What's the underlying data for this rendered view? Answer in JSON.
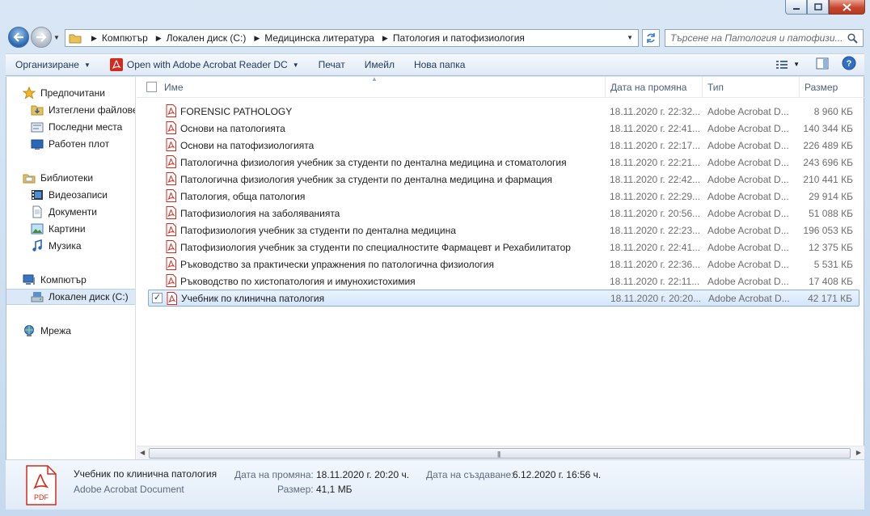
{
  "window": {
    "minimize_glyph": "—",
    "maximize_glyph": "□",
    "close_glyph": "✕"
  },
  "address": {
    "crumbs": [
      "Компютър",
      "Локален диск (C:)",
      "Медицинска литература",
      "Патология и патофизиология"
    ],
    "search_placeholder": "Търсене на Патология и патофизи..."
  },
  "toolbar": {
    "organize_label": "Организиране",
    "open_with_label": "Open with Adobe Acrobat Reader DC",
    "print_label": "Печат",
    "email_label": "Имейл",
    "new_folder_label": "Нова папка"
  },
  "nav": {
    "favorites": "Предпочитани",
    "downloads": "Изтеглени файлове",
    "recent": "Последни места",
    "desktop": "Работен плот",
    "libraries": "Библиотеки",
    "videos": "Видеозаписи",
    "documents": "Документи",
    "pictures": "Картини",
    "music": "Музика",
    "computer": "Компютър",
    "local_disk": "Локален диск (C:)",
    "network": "Мрежа"
  },
  "columns": {
    "name": "Име",
    "date": "Дата на промяна",
    "type": "Тип",
    "size": "Размер"
  },
  "files": [
    {
      "name": "FORENSIC PATHOLOGY",
      "date": "18.11.2020 г. 22:32...",
      "type": "Adobe Acrobat D...",
      "size": "8 960 КБ",
      "selected": false
    },
    {
      "name": "Основи на патологията",
      "date": "18.11.2020 г. 22:41...",
      "type": "Adobe Acrobat D...",
      "size": "140 344 КБ",
      "selected": false
    },
    {
      "name": "Основи на патофизиологията",
      "date": "18.11.2020 г. 22:17...",
      "type": "Adobe Acrobat D...",
      "size": "226 489 КБ",
      "selected": false
    },
    {
      "name": "Патологична физиология учебник за студенти по дентална медицина и стоматология",
      "date": "18.11.2020 г. 22:21...",
      "type": "Adobe Acrobat D...",
      "size": "243 696 КБ",
      "selected": false
    },
    {
      "name": "Патологична физиология учебник за студенти по дентална медицина и фармация",
      "date": "18.11.2020 г. 22:42...",
      "type": "Adobe Acrobat D...",
      "size": "210 441 КБ",
      "selected": false
    },
    {
      "name": "Патология, обща патология",
      "date": "18.11.2020 г. 22:29...",
      "type": "Adobe Acrobat D...",
      "size": "29 914 КБ",
      "selected": false
    },
    {
      "name": "Патофизиология на заболяванията",
      "date": "18.11.2020 г. 20:56...",
      "type": "Adobe Acrobat D...",
      "size": "51 088 КБ",
      "selected": false
    },
    {
      "name": "Патофизиология учебник за студенти по дентална медицина",
      "date": "18.11.2020 г. 22:23...",
      "type": "Adobe Acrobat D...",
      "size": "196 053 КБ",
      "selected": false
    },
    {
      "name": "Патофизиология учебник за студенти по специалностите Фармацевт и Рехабилитатор",
      "date": "18.11.2020 г. 22:41...",
      "type": "Adobe Acrobat D...",
      "size": "12 375 КБ",
      "selected": false
    },
    {
      "name": "Ръководство за практически упражнения по патологична физиология",
      "date": "18.11.2020 г. 22:36...",
      "type": "Adobe Acrobat D...",
      "size": "5 531 КБ",
      "selected": false
    },
    {
      "name": "Ръководство по хистопатология и имунохистохимия",
      "date": "18.11.2020 г. 22:11...",
      "type": "Adobe Acrobat D...",
      "size": "17 408 КБ",
      "selected": false
    },
    {
      "name": "Учебник по клинична патология",
      "date": "18.11.2020 г. 20:20...",
      "type": "Adobe Acrobat D...",
      "size": "42 171 КБ",
      "selected": true
    }
  ],
  "details": {
    "icon_text": "PDF",
    "name": "Учебник по клинична патология",
    "type": "Adobe Acrobat Document",
    "modified_label": "Дата на промяна:",
    "modified_value": "18.11.2020 г. 20:20 ч.",
    "size_label": "Размер:",
    "size_value": "41,1 МБ",
    "created_label": "Дата на създаване:",
    "created_value": "6.12.2020 г. 16:56 ч."
  },
  "colors": {
    "accent": "#1e395b",
    "pdf_red": "#d32a1e",
    "selection_border": "#84acdd"
  }
}
